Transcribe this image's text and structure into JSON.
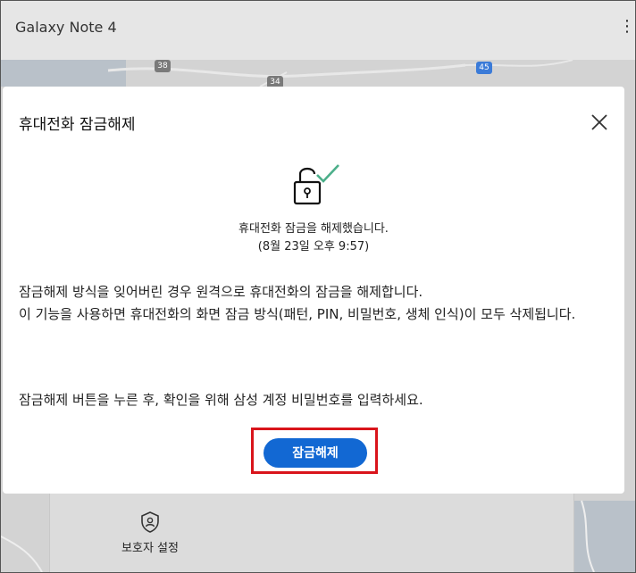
{
  "device": {
    "name": "Galaxy Note 4"
  },
  "map": {
    "roads": [
      "38",
      "34",
      "45"
    ]
  },
  "modal": {
    "title": "휴대전화 잠금해제",
    "status": "휴대전화 잠금을 해제했습니다.",
    "status_time": "(8월 23일 오후 9:57)",
    "description_1": "잠금해제 방식을 잊어버린 경우 원격으로 휴대전화의 잠금을 해제합니다.",
    "description_2": "이 기능을 사용하면 휴대전화의 화면 잠금 방식(패턴, PIN, 비밀번호, 생체 인식)이 모두 삭제됩니다.",
    "instruction": "잠금해제 버튼을 누른 후, 확인을 위해 삼성 계정 비밀번호를 입력하세요.",
    "unlock_button": "잠금해제"
  },
  "bottom_panel": {
    "guardian_label": "보호자 설정"
  },
  "colors": {
    "primary": "#1268d3",
    "check": "#4caf8a",
    "highlight": "#d9141b"
  },
  "icons": [
    "kebab-menu-icon",
    "close-icon",
    "unlocked-lock-icon",
    "check-icon",
    "shield-person-icon"
  ]
}
